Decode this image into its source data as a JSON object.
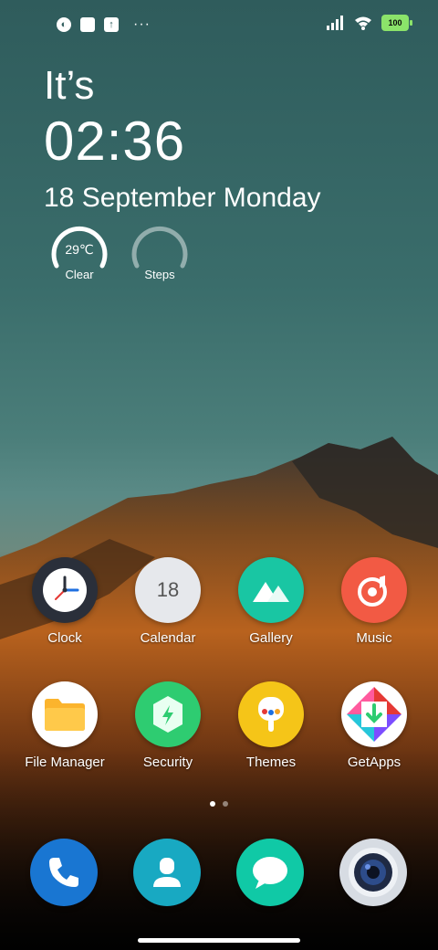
{
  "status_bar": {
    "left_icons": [
      "data-saver-icon",
      "square-app-icon",
      "upload-icon"
    ],
    "more": "···",
    "battery": "100"
  },
  "clock_widget": {
    "prefix": "It’s",
    "time": "02:36",
    "date": "18 September Monday"
  },
  "gauges": [
    {
      "value": "29℃",
      "label": "Clear"
    },
    {
      "value": "",
      "label": "Steps"
    }
  ],
  "apps": [
    {
      "label": "Clock",
      "icon": "clock-icon",
      "color": "#2a2f3a"
    },
    {
      "label": "Calendar",
      "icon": "calendar-icon",
      "color": "#e6e8ec",
      "badge": "18"
    },
    {
      "label": "Gallery",
      "icon": "gallery-icon",
      "color": "#19c6a3"
    },
    {
      "label": "Music",
      "icon": "music-icon",
      "color": "#f25a44"
    },
    {
      "label": "File Manager",
      "icon": "folder-icon",
      "color": "#ffffff"
    },
    {
      "label": "Security",
      "icon": "security-icon",
      "color": "#2ecc71"
    },
    {
      "label": "Themes",
      "icon": "themes-icon",
      "color": "#f5c518"
    },
    {
      "label": "GetApps",
      "icon": "getapps-icon",
      "color": "#ffffff"
    }
  ],
  "dock": [
    {
      "icon": "phone-icon",
      "color": "#1976d2"
    },
    {
      "icon": "contacts-icon",
      "color": "#18a9c2"
    },
    {
      "icon": "messages-icon",
      "color": "#10c9a6"
    },
    {
      "icon": "camera-icon",
      "color": "#d7dce3"
    }
  ],
  "page_indicator": {
    "pages": 2,
    "current": 1
  }
}
